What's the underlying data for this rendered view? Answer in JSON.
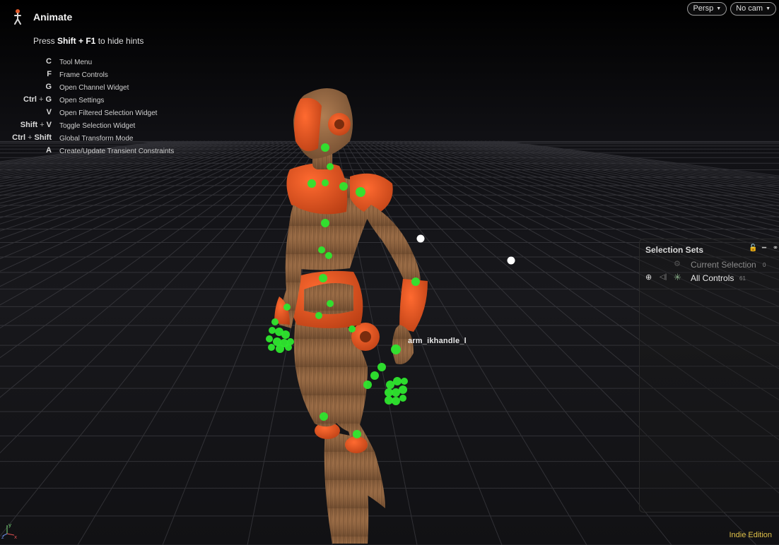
{
  "tool": {
    "title": "Animate",
    "icon": "puppet-figure-icon"
  },
  "hints": {
    "intro_prefix": "Press ",
    "intro_keys": "Shift + F1",
    "intro_suffix": " to hide hints",
    "hotkeys": [
      {
        "keys": [
          "C"
        ],
        "desc": "Tool Menu"
      },
      {
        "keys": [
          "F"
        ],
        "desc": "Frame Controls"
      },
      {
        "keys": [
          "G"
        ],
        "desc": "Open Channel Widget"
      },
      {
        "keys": [
          "Ctrl",
          "G"
        ],
        "desc": "Open Settings"
      },
      {
        "keys": [
          "V"
        ],
        "desc": "Open Filtered Selection Widget"
      },
      {
        "keys": [
          "Shift",
          "V"
        ],
        "desc": "Toggle Selection Widget"
      },
      {
        "keys": [
          "Ctrl",
          "Shift"
        ],
        "desc": "Global Transform Mode"
      },
      {
        "keys": [
          "A"
        ],
        "desc": "Create/Update Transient Constraints"
      }
    ]
  },
  "camera": {
    "view_label": "Persp",
    "cam_label": "No cam"
  },
  "selection_sets": {
    "title": "Selection Sets",
    "tools": [
      "lock-icon",
      "minus-icon",
      "link-icon"
    ],
    "items": [
      {
        "label": "Current Selection",
        "count": "0"
      },
      {
        "label": "All Controls",
        "count": "61"
      }
    ]
  },
  "viewport": {
    "handle_label": "arm_ikhandle_l"
  },
  "axis": {
    "x": "x",
    "y": "y",
    "z": "z"
  },
  "edition": "Indie Edition",
  "colors": {
    "control_green": "#2ee62e",
    "edition_yellow": "#e0c24a",
    "figure_orange": "#e8521e",
    "figure_wood": "#9a6a43"
  }
}
